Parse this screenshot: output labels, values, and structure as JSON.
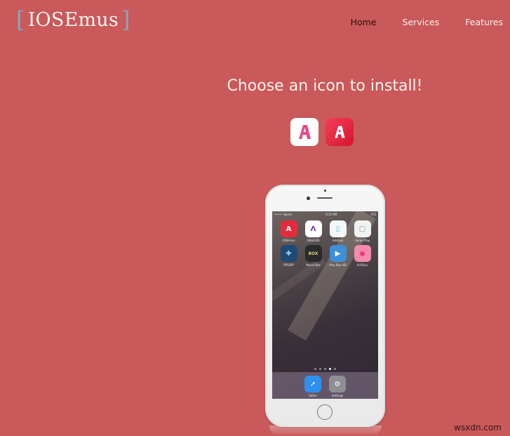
{
  "header": {
    "logo": {
      "bracket_open": "[",
      "text": "IOSEmus",
      "bracket_close": "]"
    },
    "nav": [
      {
        "label": "Home",
        "active": true
      },
      {
        "label": "Services",
        "active": false
      },
      {
        "label": "Features",
        "active": false
      }
    ]
  },
  "main": {
    "headline": "Choose an icon to install!",
    "icon_choices": [
      {
        "name": "white-icon",
        "glyph": "A",
        "background": "#ffffff",
        "glyph_color": "#e84a8a"
      },
      {
        "name": "red-icon",
        "glyph": "A",
        "background": "#e8253f",
        "glyph_color": "#ffffff"
      }
    ]
  },
  "phone": {
    "status": {
      "carrier": "••••• Sprint",
      "time": "9:35 PM",
      "battery": "ATS"
    },
    "apps": [
      {
        "label": "iOSEmus",
        "glyph": "A",
        "color": "#e52a3e",
        "glyph_color": "#ffffff"
      },
      {
        "label": "GBA4iOS",
        "glyph": "Λ",
        "color": "#ffffff",
        "glyph_color": "#6a2cb8"
      },
      {
        "label": "nds4ios",
        "glyph": "▯",
        "color": "#f3f7fa",
        "glyph_color": "#5ab3d6"
      },
      {
        "label": "Game Play",
        "glyph": "▢",
        "color": "#f2f2f2",
        "glyph_color": "#999999"
      },
      {
        "label": "PPSSPP",
        "glyph": "✚",
        "color": "#1f4a75",
        "glyph_color": "#9fd2f0"
      },
      {
        "label": "Movie Box",
        "glyph": "BOX",
        "color": "#2a2a2a",
        "glyph_color": "#d8c98a"
      },
      {
        "label": "Play Box HD",
        "glyph": "▶",
        "color": "#3d8fd8",
        "glyph_color": "#ffffff"
      },
      {
        "label": "AirShou",
        "glyph": "◉",
        "color": "#f38bb0",
        "glyph_color": "#e0305e"
      }
    ],
    "page_dots": 5,
    "active_dot": 4,
    "dock": [
      {
        "label": "Safari",
        "glyph": "➚",
        "color": "#2f8ff0"
      },
      {
        "label": "Settings",
        "glyph": "⚙",
        "color": "#8e8e93"
      }
    ]
  },
  "watermark": "wsxdn.com"
}
